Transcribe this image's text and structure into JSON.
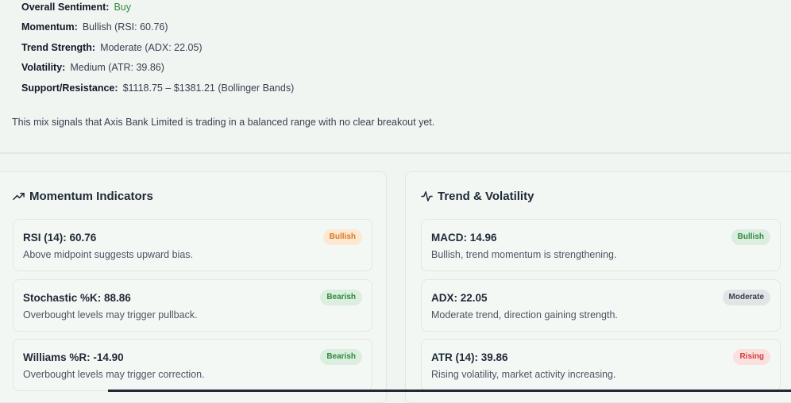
{
  "summary": {
    "overall_label": "Overall Sentiment:",
    "overall_value": "Buy",
    "momentum_label": "Momentum:",
    "momentum_value": "Bullish (RSI: 60.76)",
    "trend_label": "Trend Strength:",
    "trend_value": "Moderate (ADX: 22.05)",
    "volatility_label": "Volatility:",
    "volatility_value": "Medium (ATR: 39.86)",
    "sr_label": "Support/Resistance:",
    "sr_value": "$1118.75 – $1381.21 (Bollinger Bands)",
    "note": "This mix signals that Axis Bank Limited is trading in a balanced range with no clear breakout yet."
  },
  "momentum_panel": {
    "title": "Momentum Indicators",
    "icon": "trending-up-icon",
    "cards": [
      {
        "title": "RSI (14): 60.76",
        "desc": "Above midpoint suggests upward bias.",
        "badge": "Bullish",
        "badge_color": "#d97a1c"
      },
      {
        "title": "Stochastic %K: 88.86",
        "desc": "Overbought levels may trigger pullback.",
        "badge": "Bearish",
        "badge_color": "#2f8a3e"
      },
      {
        "title": "Williams %R: -14.90",
        "desc": "Overbought levels may trigger correction.",
        "badge": "Bearish",
        "badge_color": "#2f8a3e"
      }
    ]
  },
  "trend_panel": {
    "title": "Trend & Volatility",
    "icon": "activity-icon",
    "cards": [
      {
        "title": "MACD: 14.96",
        "desc": "Bullish, trend momentum is strengthening.",
        "badge": "Bullish",
        "badge_color": "#2f8a3e"
      },
      {
        "title": "ADX: 22.05",
        "desc": "Moderate trend, direction gaining strength.",
        "badge": "Moderate",
        "badge_color": "#374151"
      },
      {
        "title": "ATR (14): 39.86",
        "desc": "Rising volatility, market activity increasing.",
        "badge": "Rising",
        "badge_color": "#d03c3c"
      }
    ]
  }
}
